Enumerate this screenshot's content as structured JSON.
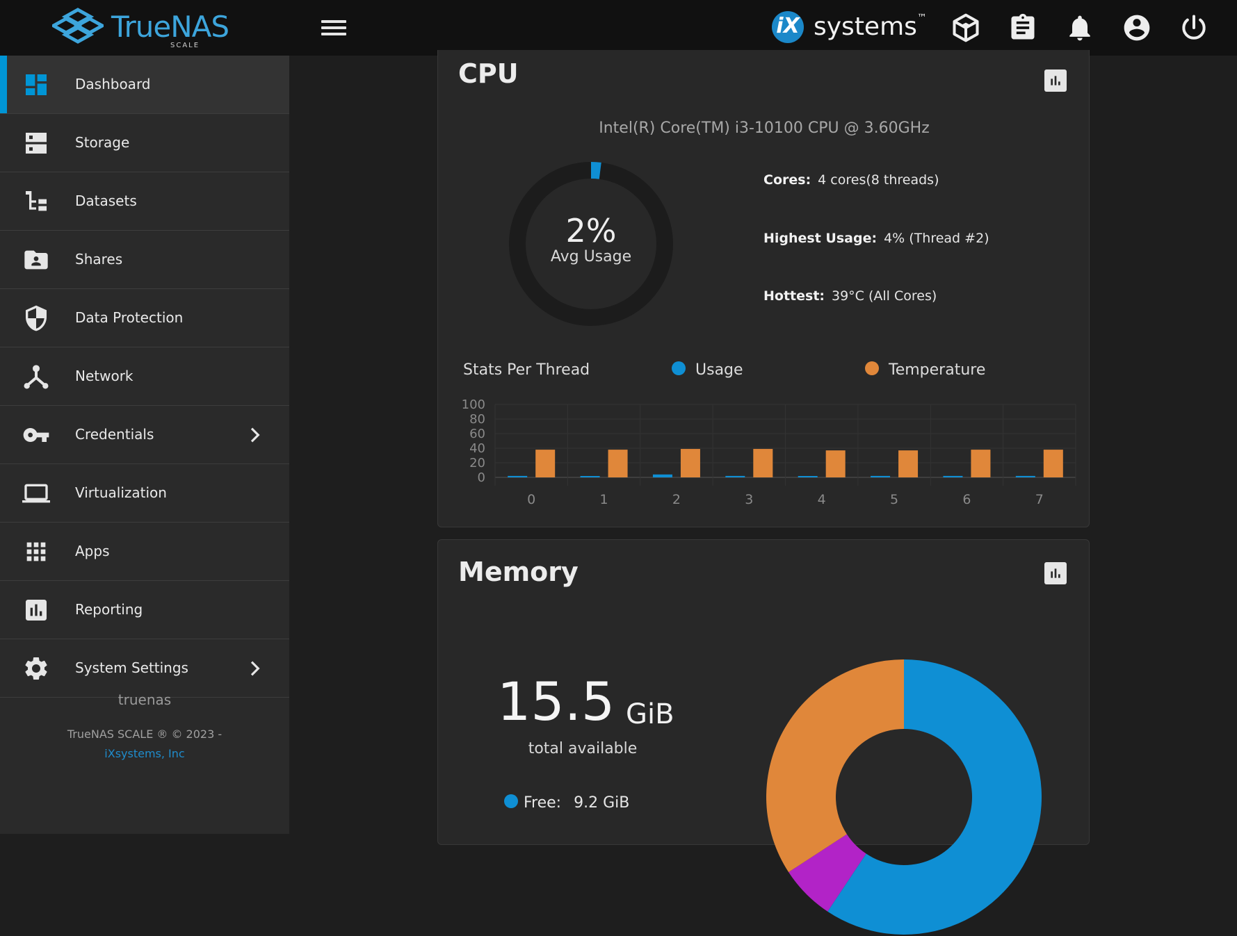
{
  "header": {
    "brand": "TrueNAS",
    "brand_sub": "SCALE",
    "partner_mark": "iX",
    "partner": "systems",
    "partner_tm": "™",
    "icons": [
      "truecommand-icon",
      "clipboard-icon",
      "bell-icon",
      "account-icon",
      "power-icon"
    ]
  },
  "sidebar": {
    "items": [
      {
        "label": "Dashboard",
        "icon": "dashboard-icon"
      },
      {
        "label": "Storage",
        "icon": "storage-icon"
      },
      {
        "label": "Datasets",
        "icon": "datasets-icon"
      },
      {
        "label": "Shares",
        "icon": "shares-icon"
      },
      {
        "label": "Data Protection",
        "icon": "shield-icon"
      },
      {
        "label": "Network",
        "icon": "network-icon"
      },
      {
        "label": "Credentials",
        "icon": "key-icon"
      },
      {
        "label": "Virtualization",
        "icon": "laptop-icon"
      },
      {
        "label": "Apps",
        "icon": "apps-grid-icon"
      },
      {
        "label": "Reporting",
        "icon": "reporting-icon"
      },
      {
        "label": "System Settings",
        "icon": "gear-icon"
      }
    ],
    "hostname": "truenas",
    "copyright": "TrueNAS SCALE ® © 2023 -",
    "company": "iXsystems, Inc"
  },
  "cpu": {
    "title": "CPU",
    "model": "Intel(R) Core(TM) i3-10100 CPU @ 3.60GHz",
    "avg_usage": "2%",
    "avg_usage_value": 2,
    "avg_usage_label": "Avg Usage",
    "cores_label": "Cores:",
    "cores_value": "4 cores(8 threads)",
    "highest_label": "Highest Usage:",
    "highest_value": "4%  (Thread #2)",
    "hottest_label": "Hottest:",
    "hottest_value": "39°C  (All Cores)",
    "stats_title": "Stats Per Thread",
    "legend_usage": "Usage",
    "legend_temp": "Temperature"
  },
  "memory": {
    "title": "Memory",
    "total": "15.5",
    "unit": "GiB",
    "total_label": "total available",
    "free_label": "Free:",
    "free_value": "9.2 GiB"
  },
  "colors": {
    "accent": "#0095d5",
    "usage": "#0f8fd4",
    "temperature": "#e0873a",
    "purple": "#b223c7"
  },
  "chart_data": [
    {
      "type": "bar",
      "categories": [
        "0",
        "1",
        "2",
        "3",
        "4",
        "5",
        "6",
        "7"
      ],
      "series": [
        {
          "name": "Usage",
          "values": [
            2,
            1,
            4,
            2,
            1,
            2,
            2,
            2
          ]
        },
        {
          "name": "Temperature",
          "values": [
            38,
            38,
            39,
            39,
            37,
            37,
            38,
            38
          ]
        }
      ],
      "yticks": [
        0,
        20,
        40,
        60,
        80,
        100
      ],
      "ylim": [
        0,
        100
      ],
      "grid": true,
      "legend": "top"
    },
    {
      "type": "pie",
      "categories": [
        "Free",
        "Purple segment",
        "Orange segment"
      ],
      "values": [
        9.2,
        1.0,
        5.3
      ]
    }
  ]
}
